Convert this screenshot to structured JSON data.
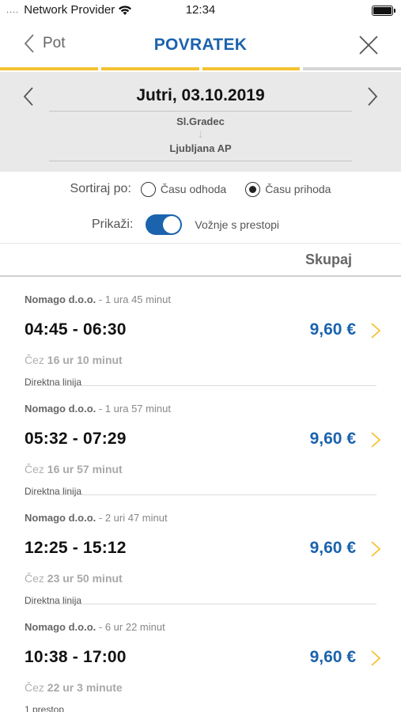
{
  "status": {
    "dots": "....",
    "carrier": "Network Provider",
    "time": "12:34"
  },
  "nav": {
    "back_label": "Pot",
    "title": "POVRATEK"
  },
  "colors": {
    "accent": "#1b63ad",
    "progress_active": "#f5c233",
    "progress_inactive": "#d6d6d6",
    "chevron": "#f5c233"
  },
  "progress": [
    true,
    true,
    true,
    false
  ],
  "date": {
    "label": "Jutri, 03.10.2019",
    "from": "Sl.Gradec",
    "arrow": "↓",
    "to": "Ljubljana AP"
  },
  "sort": {
    "label": "Sortiraj po:",
    "options": [
      {
        "label": "Času odhoda",
        "selected": false
      },
      {
        "label": "Času prihoda",
        "selected": true
      }
    ]
  },
  "show": {
    "label": "Prikaži:",
    "toggle_on": true,
    "option_label": "Vožnje s prestopi"
  },
  "table": {
    "total_header": "Skupaj"
  },
  "trips": [
    {
      "operator": "Nomago d.o.o.",
      "duration": " - 1 ura 45 minut",
      "time": "04:45 - 06:30",
      "price": "9,60 €",
      "in_prefix": "Čez ",
      "in_value": "16 ur 10 minut",
      "type": "Direktna linija"
    },
    {
      "operator": "Nomago d.o.o.",
      "duration": " - 1 ura 57 minut",
      "time": "05:32 - 07:29",
      "price": "9,60 €",
      "in_prefix": "Čez ",
      "in_value": "16 ur 57 minut",
      "type": "Direktna linija"
    },
    {
      "operator": "Nomago d.o.o.",
      "duration": " - 2 uri 47 minut",
      "time": "12:25 - 15:12",
      "price": "9,60 €",
      "in_prefix": "Čez ",
      "in_value": "23 ur 50 minut",
      "type": "Direktna linija"
    },
    {
      "operator": "Nomago d.o.o.",
      "duration": " - 6 ur 22 minut",
      "time": "10:38 - 17:00",
      "price": "9,60 €",
      "in_prefix": "Čez ",
      "in_value": "22 ur 3 minute",
      "type": "1 prestop"
    }
  ]
}
